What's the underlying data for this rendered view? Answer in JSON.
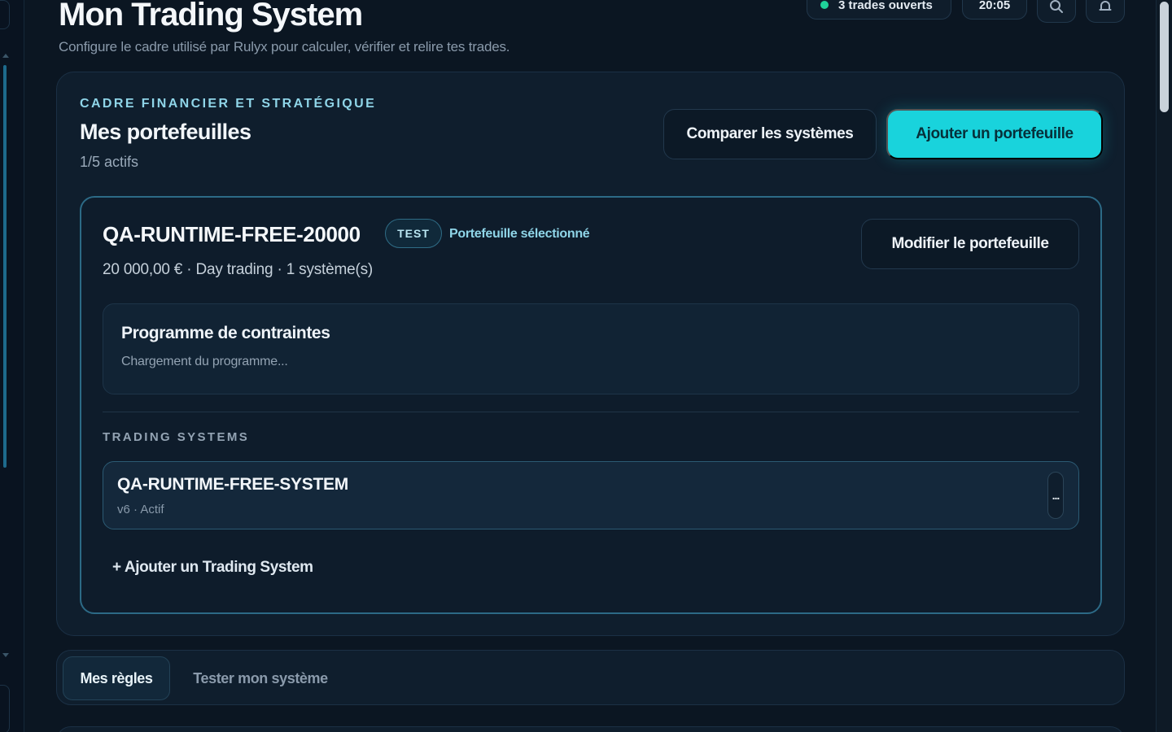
{
  "header": {
    "title": "Mon Trading System",
    "subtitle": "Configure le cadre utilisé par Rulyx pour calculer, vérifier et relire tes trades.",
    "open_trades": "3 trades ouverts",
    "time": "20:05"
  },
  "portfolios_section": {
    "eyebrow": "CADRE FINANCIER ET STRATÉGIQUE",
    "title": "Mes portefeuilles",
    "count": "1/5 actifs",
    "compare_label": "Comparer les systèmes",
    "add_label": "Ajouter un portefeuille"
  },
  "portfolio": {
    "name": "QA-RUNTIME-FREE-20000",
    "badge": "TEST",
    "selected_label": "Portefeuille sélectionné",
    "meta": "20 000,00 € · Day trading · 1 système(s)",
    "edit_label": "Modifier le portefeuille",
    "constraints": {
      "title": "Programme de contraintes",
      "status": "Chargement du programme..."
    },
    "systems_eyebrow": "TRADING SYSTEMS",
    "systems": [
      {
        "name": "QA-RUNTIME-FREE-SYSTEM",
        "meta": "v6 · Actif",
        "menu_label": "..."
      }
    ],
    "add_system_label": "+ Ajouter un Trading System"
  },
  "tabs": [
    {
      "label": "Mes règles",
      "active": true
    },
    {
      "label": "Tester mon système",
      "active": false
    }
  ],
  "colors": {
    "accent": "#19d3dc",
    "status_dot": "#1fd39a",
    "background": "#0b1622"
  },
  "icons": {
    "search": "search-icon",
    "bell": "bell-icon"
  }
}
